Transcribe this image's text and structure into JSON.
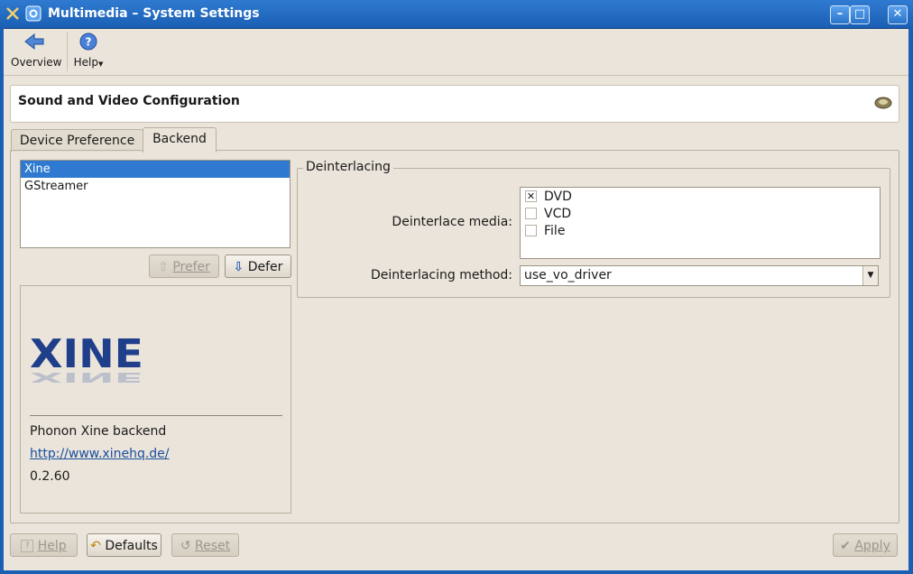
{
  "window": {
    "title": "Multimedia – System Settings",
    "minimize_glyph": "–",
    "maximize_glyph": "□",
    "close_glyph": "✕"
  },
  "toolbar": {
    "overview_label": "Overview",
    "help_label": "Help"
  },
  "header": {
    "title": "Sound and Video Configuration"
  },
  "tabs": [
    {
      "label": "Device Preference",
      "active": false
    },
    {
      "label": "Backend",
      "active": true
    }
  ],
  "backends": {
    "items": [
      {
        "label": "Xine",
        "selected": true
      },
      {
        "label": "GStreamer",
        "selected": false
      }
    ],
    "prefer_label": "Prefer",
    "defer_label": "Defer"
  },
  "backend_info": {
    "logo_text": "XINE",
    "description": "Phonon Xine backend",
    "url": "http://www.xinehq.de/",
    "version": "0.2.60"
  },
  "deinterlacing": {
    "group_title": "Deinterlacing",
    "media_label": "Deinterlace media:",
    "media_options": [
      {
        "label": "DVD",
        "checked": true
      },
      {
        "label": "VCD",
        "checked": false
      },
      {
        "label": "File",
        "checked": false
      }
    ],
    "method_label": "Deinterlacing method:",
    "method_value": "use_vo_driver"
  },
  "footer": {
    "help_label": "Help",
    "defaults_label": "Defaults",
    "reset_label": "Reset",
    "apply_label": "Apply"
  },
  "colors": {
    "title_bar": "#1a5fb4",
    "selection": "#2f7ad0",
    "window_bg": "#eae4da"
  }
}
